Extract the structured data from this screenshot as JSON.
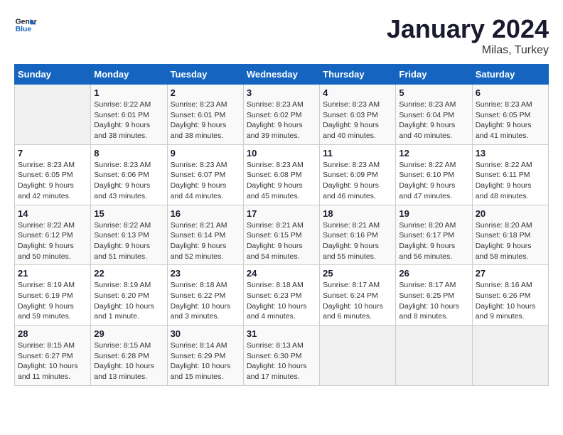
{
  "header": {
    "logo_line1": "General",
    "logo_line2": "Blue",
    "title": "January 2024",
    "subtitle": "Milas, Turkey"
  },
  "columns": [
    "Sunday",
    "Monday",
    "Tuesday",
    "Wednesday",
    "Thursday",
    "Friday",
    "Saturday"
  ],
  "weeks": [
    {
      "days": [
        {
          "number": "",
          "info": "",
          "empty": true
        },
        {
          "number": "1",
          "info": "Sunrise: 8:22 AM\nSunset: 6:01 PM\nDaylight: 9 hours\nand 38 minutes."
        },
        {
          "number": "2",
          "info": "Sunrise: 8:23 AM\nSunset: 6:01 PM\nDaylight: 9 hours\nand 38 minutes."
        },
        {
          "number": "3",
          "info": "Sunrise: 8:23 AM\nSunset: 6:02 PM\nDaylight: 9 hours\nand 39 minutes."
        },
        {
          "number": "4",
          "info": "Sunrise: 8:23 AM\nSunset: 6:03 PM\nDaylight: 9 hours\nand 40 minutes."
        },
        {
          "number": "5",
          "info": "Sunrise: 8:23 AM\nSunset: 6:04 PM\nDaylight: 9 hours\nand 40 minutes."
        },
        {
          "number": "6",
          "info": "Sunrise: 8:23 AM\nSunset: 6:05 PM\nDaylight: 9 hours\nand 41 minutes."
        }
      ]
    },
    {
      "days": [
        {
          "number": "7",
          "info": "Sunrise: 8:23 AM\nSunset: 6:05 PM\nDaylight: 9 hours\nand 42 minutes."
        },
        {
          "number": "8",
          "info": "Sunrise: 8:23 AM\nSunset: 6:06 PM\nDaylight: 9 hours\nand 43 minutes."
        },
        {
          "number": "9",
          "info": "Sunrise: 8:23 AM\nSunset: 6:07 PM\nDaylight: 9 hours\nand 44 minutes."
        },
        {
          "number": "10",
          "info": "Sunrise: 8:23 AM\nSunset: 6:08 PM\nDaylight: 9 hours\nand 45 minutes."
        },
        {
          "number": "11",
          "info": "Sunrise: 8:23 AM\nSunset: 6:09 PM\nDaylight: 9 hours\nand 46 minutes."
        },
        {
          "number": "12",
          "info": "Sunrise: 8:22 AM\nSunset: 6:10 PM\nDaylight: 9 hours\nand 47 minutes."
        },
        {
          "number": "13",
          "info": "Sunrise: 8:22 AM\nSunset: 6:11 PM\nDaylight: 9 hours\nand 48 minutes."
        }
      ]
    },
    {
      "days": [
        {
          "number": "14",
          "info": "Sunrise: 8:22 AM\nSunset: 6:12 PM\nDaylight: 9 hours\nand 50 minutes."
        },
        {
          "number": "15",
          "info": "Sunrise: 8:22 AM\nSunset: 6:13 PM\nDaylight: 9 hours\nand 51 minutes."
        },
        {
          "number": "16",
          "info": "Sunrise: 8:21 AM\nSunset: 6:14 PM\nDaylight: 9 hours\nand 52 minutes."
        },
        {
          "number": "17",
          "info": "Sunrise: 8:21 AM\nSunset: 6:15 PM\nDaylight: 9 hours\nand 54 minutes."
        },
        {
          "number": "18",
          "info": "Sunrise: 8:21 AM\nSunset: 6:16 PM\nDaylight: 9 hours\nand 55 minutes."
        },
        {
          "number": "19",
          "info": "Sunrise: 8:20 AM\nSunset: 6:17 PM\nDaylight: 9 hours\nand 56 minutes."
        },
        {
          "number": "20",
          "info": "Sunrise: 8:20 AM\nSunset: 6:18 PM\nDaylight: 9 hours\nand 58 minutes."
        }
      ]
    },
    {
      "days": [
        {
          "number": "21",
          "info": "Sunrise: 8:19 AM\nSunset: 6:19 PM\nDaylight: 9 hours\nand 59 minutes."
        },
        {
          "number": "22",
          "info": "Sunrise: 8:19 AM\nSunset: 6:20 PM\nDaylight: 10 hours\nand 1 minute."
        },
        {
          "number": "23",
          "info": "Sunrise: 8:18 AM\nSunset: 6:22 PM\nDaylight: 10 hours\nand 3 minutes."
        },
        {
          "number": "24",
          "info": "Sunrise: 8:18 AM\nSunset: 6:23 PM\nDaylight: 10 hours\nand 4 minutes."
        },
        {
          "number": "25",
          "info": "Sunrise: 8:17 AM\nSunset: 6:24 PM\nDaylight: 10 hours\nand 6 minutes."
        },
        {
          "number": "26",
          "info": "Sunrise: 8:17 AM\nSunset: 6:25 PM\nDaylight: 10 hours\nand 8 minutes."
        },
        {
          "number": "27",
          "info": "Sunrise: 8:16 AM\nSunset: 6:26 PM\nDaylight: 10 hours\nand 9 minutes."
        }
      ]
    },
    {
      "days": [
        {
          "number": "28",
          "info": "Sunrise: 8:15 AM\nSunset: 6:27 PM\nDaylight: 10 hours\nand 11 minutes."
        },
        {
          "number": "29",
          "info": "Sunrise: 8:15 AM\nSunset: 6:28 PM\nDaylight: 10 hours\nand 13 minutes."
        },
        {
          "number": "30",
          "info": "Sunrise: 8:14 AM\nSunset: 6:29 PM\nDaylight: 10 hours\nand 15 minutes."
        },
        {
          "number": "31",
          "info": "Sunrise: 8:13 AM\nSunset: 6:30 PM\nDaylight: 10 hours\nand 17 minutes."
        },
        {
          "number": "",
          "info": "",
          "empty": true
        },
        {
          "number": "",
          "info": "",
          "empty": true
        },
        {
          "number": "",
          "info": "",
          "empty": true
        }
      ]
    }
  ]
}
